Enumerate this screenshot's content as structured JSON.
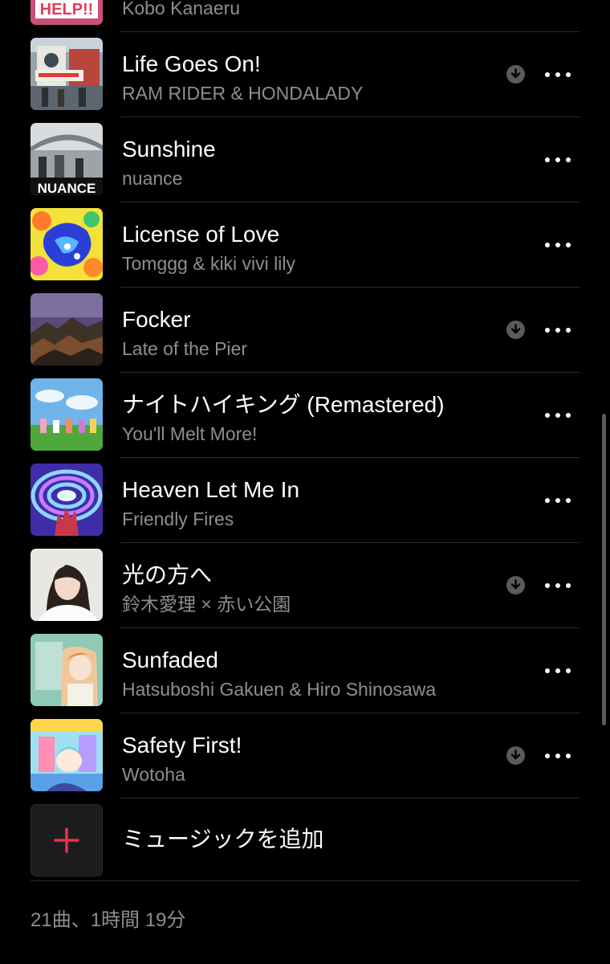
{
  "tracks": [
    {
      "title": "",
      "artist": "Kobo Kanaeru",
      "downloaded": false,
      "art_text": "HELP!!"
    },
    {
      "title": "Life Goes On!",
      "artist": "RAM RIDER & HONDALADY",
      "downloaded": true,
      "art_text": ""
    },
    {
      "title": "Sunshine",
      "artist": "nuance",
      "downloaded": false,
      "art_text": "NUANCE"
    },
    {
      "title": "License of Love",
      "artist": "Tomggg & kiki vivi lily",
      "downloaded": false,
      "art_text": ""
    },
    {
      "title": "Focker",
      "artist": "Late of the Pier",
      "downloaded": true,
      "art_text": ""
    },
    {
      "title": "ナイトハイキング (Remastered)",
      "artist": "You'll Melt More!",
      "downloaded": false,
      "art_text": ""
    },
    {
      "title": "Heaven Let Me In",
      "artist": "Friendly Fires",
      "downloaded": false,
      "art_text": ""
    },
    {
      "title": "光の方へ",
      "artist": "鈴木愛理 × 赤い公園",
      "downloaded": true,
      "art_text": ""
    },
    {
      "title": "Sunfaded",
      "artist": "Hatsuboshi Gakuen & Hiro Shinosawa",
      "downloaded": false,
      "art_text": ""
    },
    {
      "title": "Safety First!",
      "artist": "Wotoha",
      "downloaded": true,
      "art_text": ""
    }
  ],
  "add_music": {
    "label": "ミュージックを追加",
    "icon": "plus-icon"
  },
  "footer": {
    "summary": "21曲、1時間 19分"
  },
  "colors": {
    "background": "#000000",
    "secondary_text": "#8e8e93",
    "accent": "#fa2d48",
    "separator": "#2c2c2e"
  }
}
